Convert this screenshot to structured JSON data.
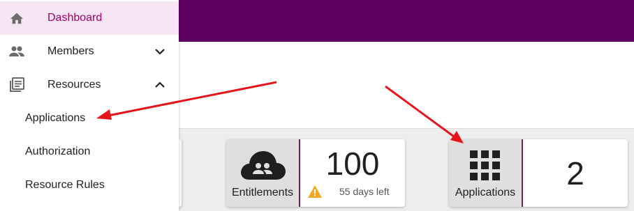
{
  "sidebar": {
    "items": [
      {
        "label": "Dashboard",
        "icon": "home-icon",
        "active": true
      },
      {
        "label": "Members",
        "icon": "people-icon",
        "chevron": "chevron-down-icon"
      },
      {
        "label": "Resources",
        "icon": "library-icon",
        "chevron": "chevron-up-icon"
      }
    ],
    "subitems": [
      "Applications",
      "Authorization",
      "Resource Rules"
    ]
  },
  "cards": {
    "entitlements": {
      "label": "Entitlements",
      "value": "100",
      "status": "55 days left",
      "icon": "cloud-people-icon",
      "status_icon": "warning-icon"
    },
    "applications": {
      "label": "Applications",
      "value": "2",
      "icon": "grid-icon"
    }
  },
  "colors": {
    "appbar": "#5e005e",
    "active_bg": "#f6e5f2",
    "active_text": "#a2006e",
    "tile_bg": "#e1dfdd",
    "warning": "#f5a623",
    "arrow": "#e8141c"
  }
}
